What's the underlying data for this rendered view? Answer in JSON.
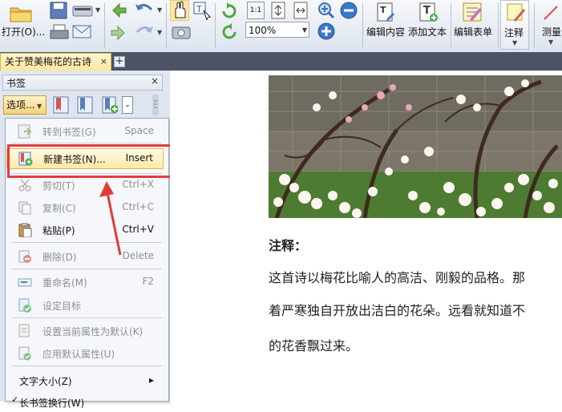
{
  "toolbar": {
    "open_label": "打开(O)...",
    "zoom_value": "100%",
    "edit_content_label": "编辑内容",
    "add_text_label": "添加文本",
    "edit_form_label": "编辑表单",
    "annotate_label": "注释",
    "measure_label": "测量",
    "fit_page_label": "1:1"
  },
  "tabs": {
    "document_tab": "关于赞美梅花的古诗",
    "close_glyph": "×",
    "new_tab_glyph": "+"
  },
  "panel": {
    "title": "书签",
    "close_glyph": "×",
    "options_label": "选项..."
  },
  "menu": {
    "items": [
      {
        "label": "转到书签(G)",
        "shortcut": "Space",
        "enabled": false
      },
      {
        "label": "新建书签(N)...",
        "shortcut": "Insert",
        "enabled": true
      },
      {
        "label": "剪切(T)",
        "shortcut": "Ctrl+X",
        "enabled": false
      },
      {
        "label": "复制(C)",
        "shortcut": "Ctrl+C",
        "enabled": false
      },
      {
        "label": "粘贴(P)",
        "shortcut": "Ctrl+V",
        "enabled": true
      },
      {
        "label": "删除(D)",
        "shortcut": "Delete",
        "enabled": false
      },
      {
        "label": "重命名(M)",
        "shortcut": "F2",
        "enabled": false
      },
      {
        "label": "设定目标",
        "shortcut": "",
        "enabled": false
      },
      {
        "label": "设置当前属性为默认(K)",
        "shortcut": "",
        "enabled": false
      },
      {
        "label": "应用默认属性(U)",
        "shortcut": "",
        "enabled": false
      },
      {
        "label": "文字大小(Z)",
        "shortcut": "▸",
        "enabled": true
      },
      {
        "label": "长书签换行(W)",
        "shortcut": "",
        "enabled": true
      }
    ]
  },
  "document": {
    "note_title": "注释：",
    "lines": [
      "这首诗以梅花比喻人的高洁、刚毅的品格。那",
      "着严寒独自开放出洁白的花朵。远看就知道不",
      "的花香飘过来。"
    ]
  },
  "colors": {
    "highlight": "#e23b3b",
    "tab_active": "#ffe79a",
    "toolbar_bg": "#dde4ee"
  }
}
